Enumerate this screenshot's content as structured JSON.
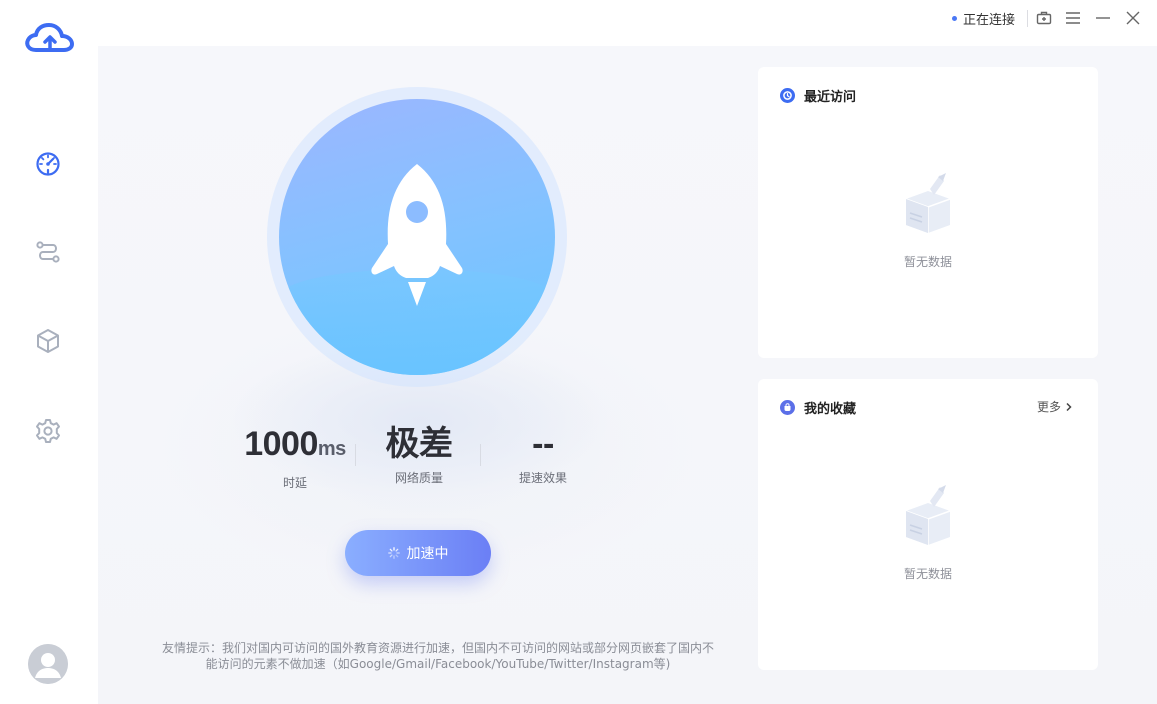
{
  "topbar": {
    "status_text": "正在连接"
  },
  "colors": {
    "accent": "#4a78f5",
    "button_gradient_start": "#8aaeff",
    "button_gradient_end": "#6b7ff5"
  },
  "metrics": {
    "latency": {
      "value": "1000",
      "unit": "ms",
      "label": "时延"
    },
    "quality": {
      "value": "极差",
      "label": "网络质量"
    },
    "speedup": {
      "value": "--",
      "label": "提速效果"
    }
  },
  "accelerate_button": {
    "label": "加速中"
  },
  "tip": {
    "line1": "友情提示：我们对国内可访问的国外教育资源进行加速，但国内不可访问的网站或部分网页嵌套了国内不",
    "line2": "能访问的元素不做加速（如Google/Gmail/Facebook/YouTube/Twitter/Instagram等)"
  },
  "recent": {
    "title": "最近访问",
    "empty_text": "暂无数据"
  },
  "favorites": {
    "title": "我的收藏",
    "more_label": "更多",
    "empty_text": "暂无数据"
  },
  "icons": {
    "logo": "cloud-upload-icon",
    "nav": [
      "speedometer-icon",
      "route-icon",
      "cube-icon",
      "gear-icon"
    ],
    "topbar": [
      "toolbox-icon",
      "menu-icon",
      "minimize-icon",
      "close-icon"
    ]
  }
}
